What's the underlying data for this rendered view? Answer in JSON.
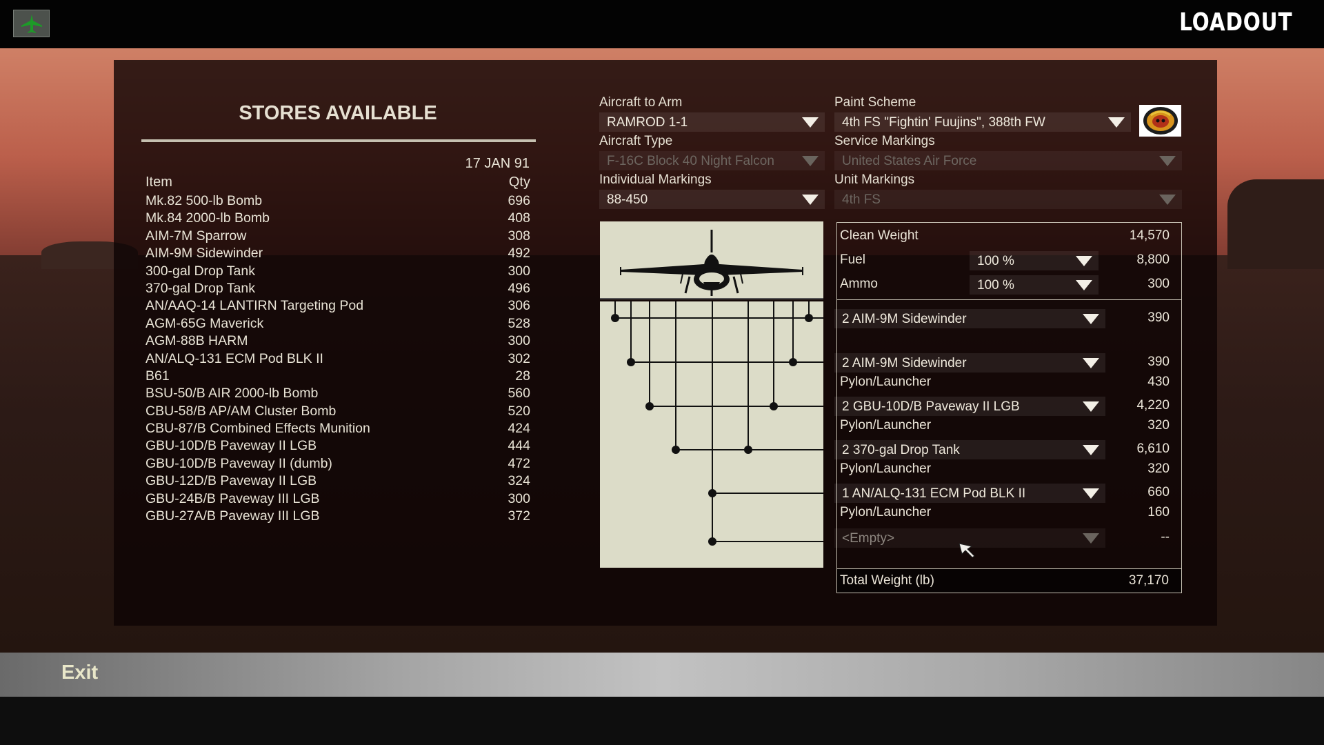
{
  "screen_title": "LOADOUT",
  "stores": {
    "title": "STORES AVAILABLE",
    "date": "17 JAN 91",
    "col_item": "Item",
    "col_qty": "Qty",
    "items": [
      {
        "name": "Mk.82 500-lb Bomb",
        "qty": "696"
      },
      {
        "name": "Mk.84 2000-lb Bomb",
        "qty": "408"
      },
      {
        "name": "AIM-7M Sparrow",
        "qty": "308"
      },
      {
        "name": "AIM-9M Sidewinder",
        "qty": "492"
      },
      {
        "name": "300-gal Drop Tank",
        "qty": "300"
      },
      {
        "name": "370-gal Drop Tank",
        "qty": "496"
      },
      {
        "name": "AN/AAQ-14 LANTIRN Targeting Pod",
        "qty": "306"
      },
      {
        "name": "AGM-65G Maverick",
        "qty": "528"
      },
      {
        "name": "AGM-88B HARM",
        "qty": "300"
      },
      {
        "name": "AN/ALQ-131 ECM Pod BLK II",
        "qty": "302"
      },
      {
        "name": "B61",
        "qty": "28"
      },
      {
        "name": "BSU-50/B AIR 2000-lb Bomb",
        "qty": "560"
      },
      {
        "name": "CBU-58/B AP/AM Cluster Bomb",
        "qty": "520"
      },
      {
        "name": "CBU-87/B Combined Effects Munition",
        "qty": "424"
      },
      {
        "name": "GBU-10D/B Paveway II LGB",
        "qty": "444"
      },
      {
        "name": "GBU-10D/B Paveway II (dumb)",
        "qty": "472"
      },
      {
        "name": "GBU-12D/B Paveway II LGB",
        "qty": "324"
      },
      {
        "name": "GBU-24B/B Paveway III LGB",
        "qty": "300"
      },
      {
        "name": "GBU-27A/B Paveway III LGB",
        "qty": "372"
      }
    ]
  },
  "form": {
    "aircraft_to_arm": {
      "label": "Aircraft to Arm",
      "value": "RAMROD 1-1"
    },
    "paint_scheme": {
      "label": "Paint Scheme",
      "value": "4th FS \"Fightin' Fuujins\", 388th FW"
    },
    "aircraft_type": {
      "label": "Aircraft Type",
      "value": "F-16C Block 40 Night Falcon"
    },
    "service_markings": {
      "label": "Service Markings",
      "value": "United States Air Force"
    },
    "individual_markings": {
      "label": "Individual Markings",
      "value": "88-450"
    },
    "unit_markings": {
      "label": "Unit Markings",
      "value": "4th FS"
    }
  },
  "weights": {
    "clean_weight_label": "Clean Weight",
    "clean_weight": "14,570",
    "fuel_label": "Fuel",
    "fuel_select": "100 %",
    "fuel_weight": "8,800",
    "ammo_label": "Ammo",
    "ammo_select": "100 %",
    "ammo_weight": "300",
    "stations": [
      {
        "store": "2 AIM-9M Sidewinder",
        "weight": "390"
      },
      {
        "store": "2 AIM-9M Sidewinder",
        "weight": "390",
        "pylon_label": "Pylon/Launcher",
        "pylon_weight": "430"
      },
      {
        "store": "2 GBU-10D/B Paveway II LGB",
        "weight": "4,220",
        "pylon_label": "Pylon/Launcher",
        "pylon_weight": "320"
      },
      {
        "store": "2 370-gal Drop Tank",
        "weight": "6,610",
        "pylon_label": "Pylon/Launcher",
        "pylon_weight": "320"
      },
      {
        "store": "1 AN/ALQ-131 ECM Pod BLK II",
        "weight": "660",
        "pylon_label": "Pylon/Launcher",
        "pylon_weight": "160"
      },
      {
        "store": "<Empty>",
        "weight": "--"
      }
    ],
    "total_label": "Total Weight (lb)",
    "total": "37,170"
  },
  "footer": {
    "exit_label": "Exit"
  },
  "icons": {
    "menu": "aircraft-icon",
    "insignia": "squadron-insignia-icon",
    "cursor": "mouse-pointer-icon"
  },
  "colors": {
    "panel": "#0e0404",
    "diagram_bg": "#dcdcc8",
    "sky_top": "#cf8066"
  }
}
